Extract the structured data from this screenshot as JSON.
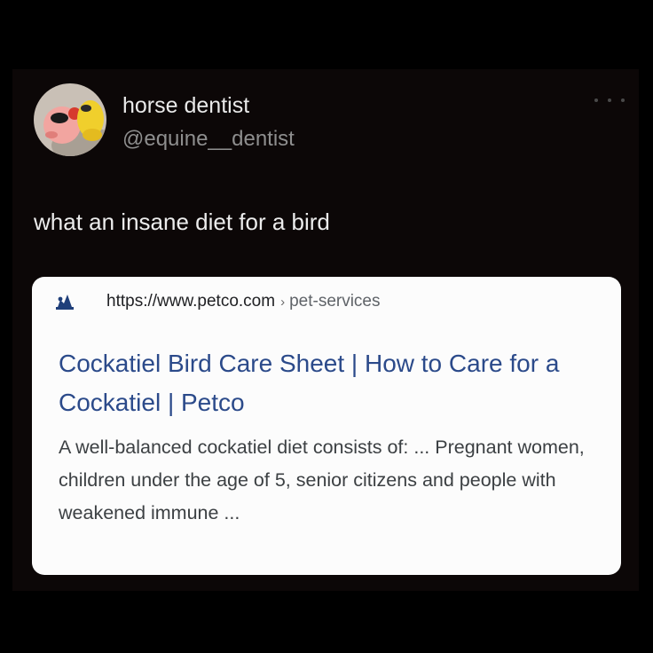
{
  "tweet": {
    "display_name": "horse dentist",
    "handle": "@equine__dentist",
    "more_icon": "more-horizontal-icon",
    "text": "what an insane diet for a bird"
  },
  "search_result": {
    "favicon": "petco-logo-icon",
    "url": "https://www.petco.com",
    "breadcrumb_separator": "›",
    "breadcrumb_path": "pet-services",
    "title": "Cockatiel Bird Care Sheet | How to Care for a Cockatiel | Petco",
    "snippet": "A well-balanced cockatiel diet consists of: ... Pregnant women, children under the age of 5, senior citizens and people with weakened immune ..."
  },
  "colors": {
    "background": "#000000",
    "tweet_background": "#0c0707",
    "card_background": "#fcfcfc",
    "title_link": "#2b4a8a",
    "snippet_text": "#3c4043",
    "favicon": "#1f3f7a"
  }
}
